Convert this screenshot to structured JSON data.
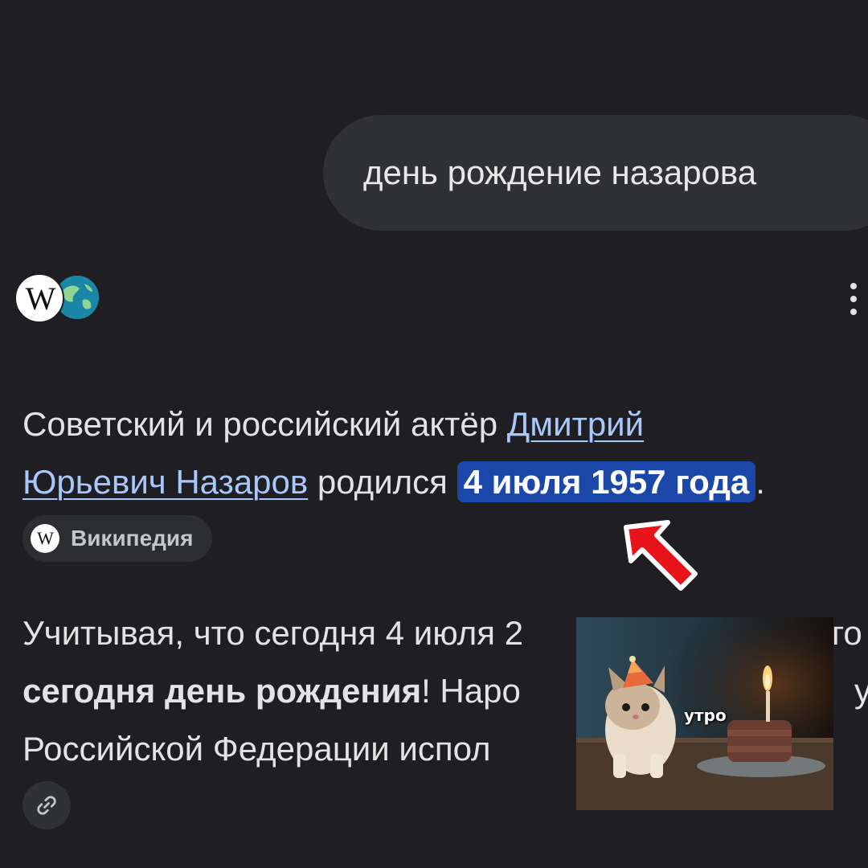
{
  "query": {
    "text": "день рождение назарова"
  },
  "source": {
    "wiki_glyph": "W",
    "menu_icon": "more-vert-icon"
  },
  "answer": {
    "part1": "Советский и российский актёр ",
    "link1": "Дмитрий",
    "link2": "Юрьевич Назаров",
    "part2": " родился ",
    "highlight": "4 июля 1957 года",
    "part3": "."
  },
  "chip": {
    "glyph": "W",
    "label": "Википедия"
  },
  "para2": {
    "line1": "Учитывая, что сегодня 4 июля 2",
    "line1_end": "го",
    "line2_bold": "сегодня день рождения",
    "line2_rest": "! Наро",
    "line2_end": "у",
    "line3": "Российской Федерации испол"
  },
  "meme": {
    "caption": "утро"
  },
  "colors": {
    "background": "#1f1f23",
    "bubble": "#303134",
    "link": "#a8c7fa",
    "highlight": "#1b48a8",
    "arrow": "#e8141b"
  }
}
